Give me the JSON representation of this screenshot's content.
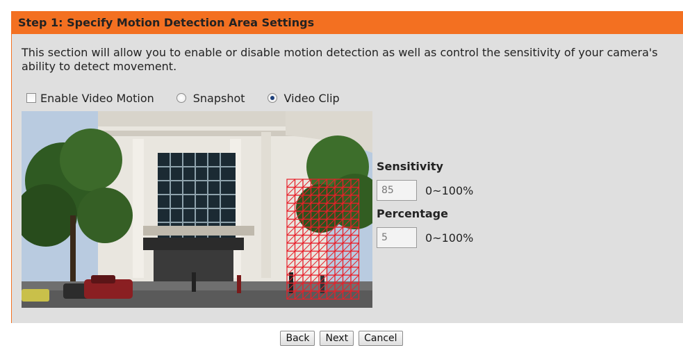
{
  "header": {
    "title": "Step 1: Specify Motion Detection Area Settings"
  },
  "description": "This section will allow you to enable or disable motion detection as well as control the sensitivity of your camera's ability to detect movement.",
  "options": {
    "enable_video_motion": {
      "label": "Enable Video Motion",
      "checked": false
    },
    "snapshot": {
      "label": "Snapshot",
      "selected": false
    },
    "video_clip": {
      "label": "Video Clip",
      "selected": true
    }
  },
  "sensitivity": {
    "label": "Sensitivity",
    "value": "85",
    "range": "0~100%"
  },
  "percentage": {
    "label": "Percentage",
    "value": "5",
    "range": "0~100%"
  },
  "buttons": {
    "back": "Back",
    "next": "Next",
    "cancel": "Cancel"
  },
  "colors": {
    "accent": "#f37021",
    "panel": "#dfdfdf",
    "grid": "#e8202a"
  }
}
